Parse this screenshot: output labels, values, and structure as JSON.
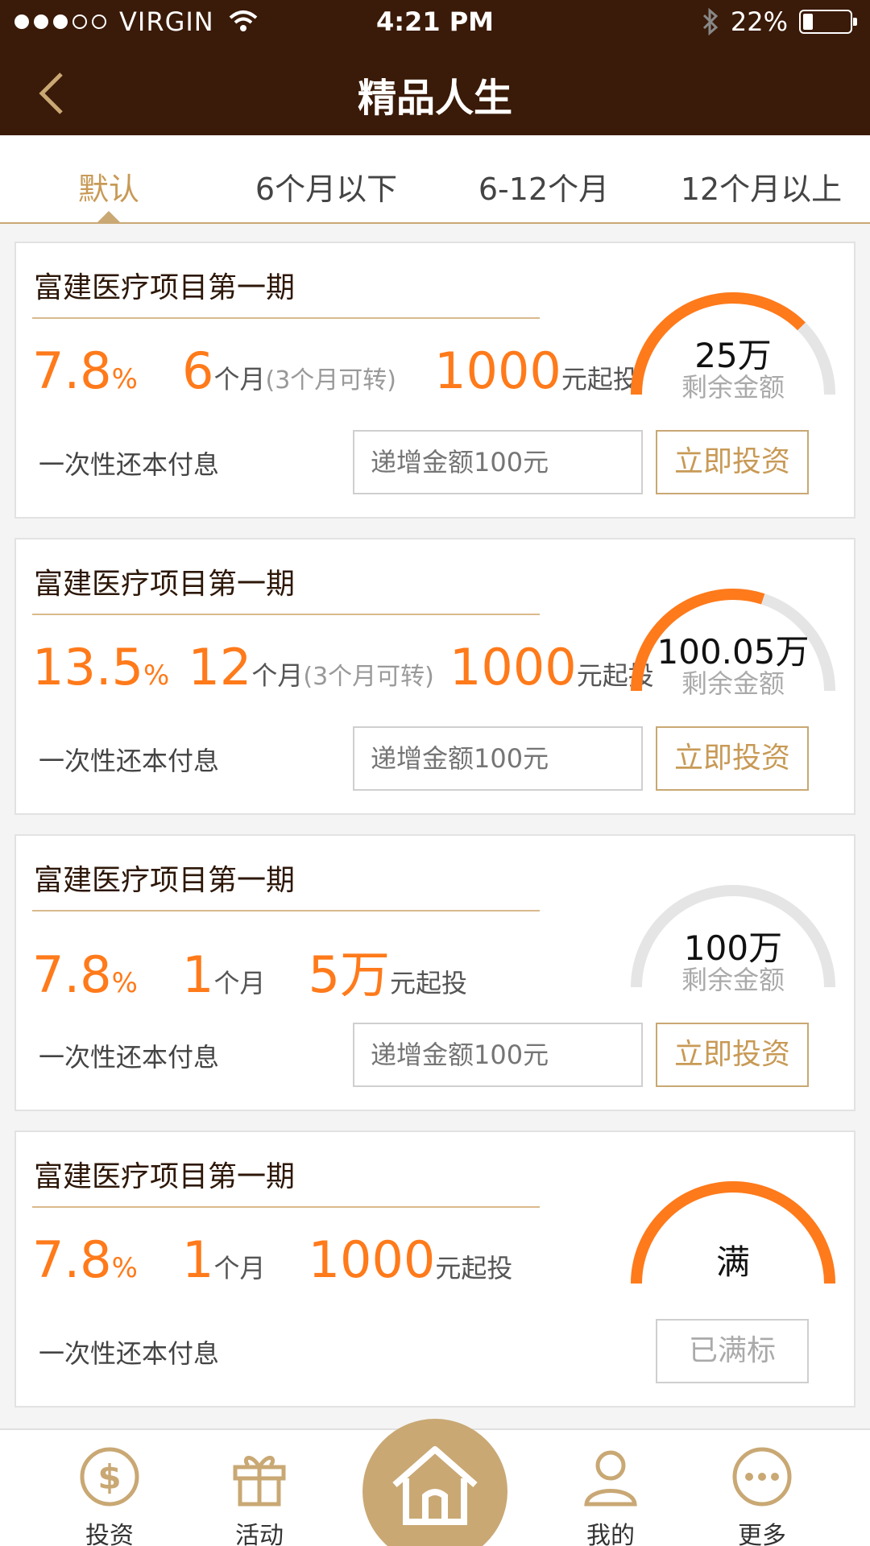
{
  "status": {
    "carrier": "VIRGIN",
    "time": "4:21 PM",
    "battery": "22%",
    "battery_level": 0.22
  },
  "header": {
    "title": "精品人生"
  },
  "tabs": [
    {
      "label": "默认",
      "active": true
    },
    {
      "label": "6个月以下",
      "active": false
    },
    {
      "label": "6-12个月",
      "active": false
    },
    {
      "label": "12个月以上",
      "active": false
    }
  ],
  "cards": [
    {
      "title": "富建医疗项目第一期",
      "rate": "7.8",
      "rate_unit": "%",
      "term": "6",
      "term_unit": "个月",
      "term_note": "(3个月可转)",
      "min": "1000",
      "min_unit": "元起投",
      "method": "一次性还本付息",
      "input_placeholder": "递增金额100元",
      "button": "立即投资",
      "gauge_amount": "25万",
      "gauge_label": "剩余金额",
      "progress": 0.75
    },
    {
      "title": "富建医疗项目第一期",
      "rate": "13.5",
      "rate_unit": "%",
      "term": "12",
      "term_unit": "个月",
      "term_note": "(3个月可转)",
      "min": "1000",
      "min_unit": "元起投",
      "method": "一次性还本付息",
      "input_placeholder": "递增金额100元",
      "button": "立即投资",
      "gauge_amount": "100.05万",
      "gauge_label": "剩余金额",
      "progress": 0.6
    },
    {
      "title": "富建医疗项目第一期",
      "rate": "7.8",
      "rate_unit": "%",
      "term": "1",
      "term_unit": "个月",
      "term_note": "",
      "min": "5万",
      "min_unit": "元起投",
      "method": "一次性还本付息",
      "input_placeholder": "递增金额100元",
      "button": "立即投资",
      "gauge_amount": "100万",
      "gauge_label": "剩余金额",
      "progress": 0
    },
    {
      "title": "富建医疗项目第一期",
      "rate": "7.8",
      "rate_unit": "%",
      "term": "1",
      "term_unit": "个月",
      "term_note": "",
      "min": "1000",
      "min_unit": "元起投",
      "method": "一次性还本付息",
      "full_button": "已满标",
      "gauge_amount": "满",
      "progress": 1
    }
  ],
  "nav": {
    "invest": "投资",
    "activity": "活动",
    "home": "首页",
    "mine": "我的",
    "more": "更多"
  },
  "colors": {
    "header_bg": "#3a1a08",
    "accent": "#ff7a1a",
    "gold": "#c9a874"
  }
}
